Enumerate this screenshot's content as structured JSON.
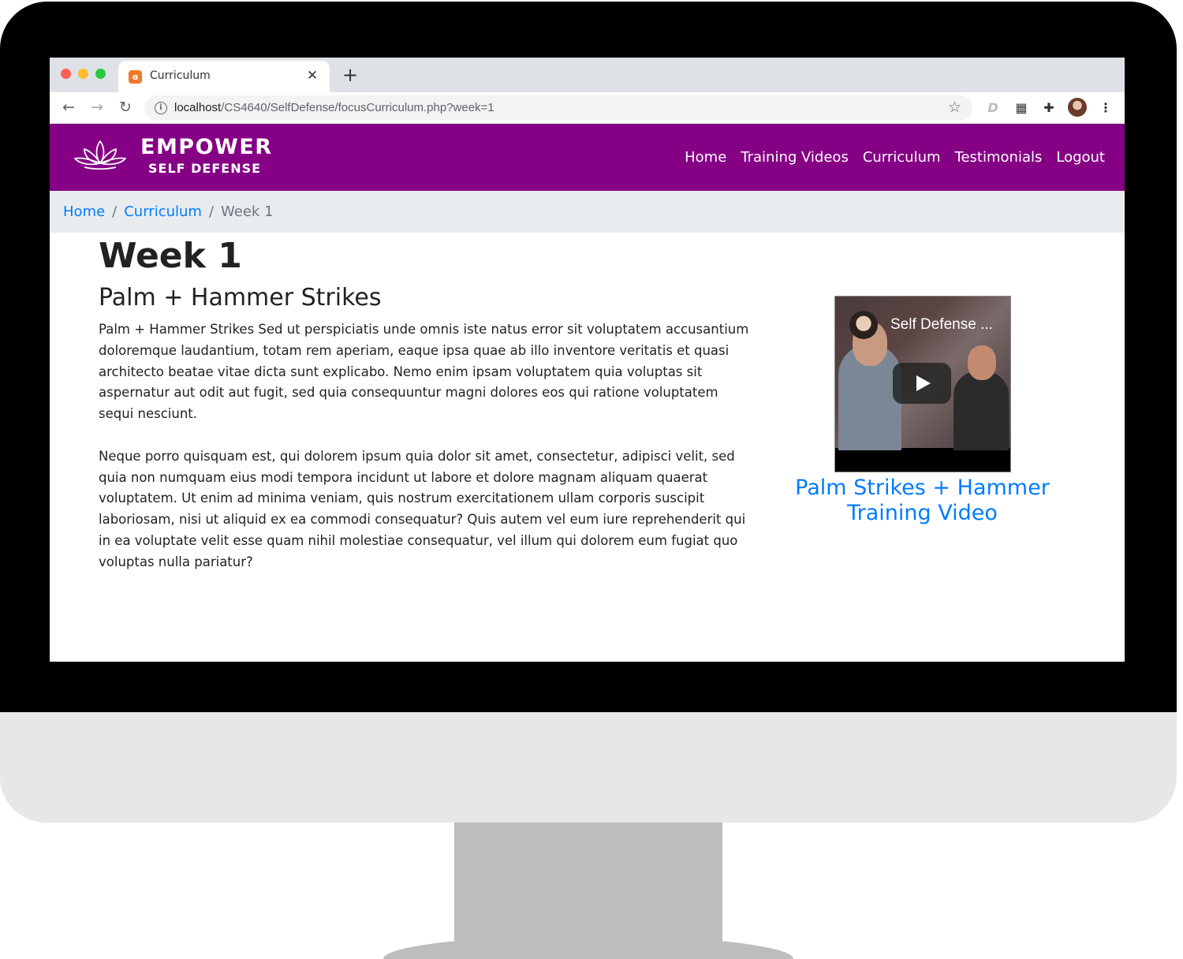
{
  "browser": {
    "tab_title": "Curriculum",
    "url_host": "localhost",
    "url_path": "/CS4640/SelfDefense/focusCurriculum.php?week=1"
  },
  "site": {
    "brand_name": "EMPOWER",
    "brand_sub": "SELF DEFENSE",
    "nav": [
      "Home",
      "Training Videos",
      "Curriculum",
      "Testimonials",
      "Logout"
    ],
    "brand_color": "#850085"
  },
  "breadcrumb": {
    "items": [
      "Home",
      "Curriculum"
    ],
    "current": "Week 1"
  },
  "content": {
    "week_title": "Week 1",
    "lesson_title": "Palm + Hammer Strikes",
    "paragraphs": [
      "Palm + Hammer Strikes Sed ut perspiciatis unde omnis iste natus error sit voluptatem accusantium doloremque laudantium, totam rem aperiam, eaque ipsa quae ab illo inventore veritatis et quasi architecto beatae vitae dicta sunt explicabo. Nemo enim ipsam voluptatem quia voluptas sit aspernatur aut odit aut fugit, sed quia consequuntur magni dolores eos qui ratione voluptatem sequi nesciunt.",
      "Neque porro quisquam est, qui dolorem ipsum quia dolor sit amet, consectetur, adipisci velit, sed quia non numquam eius modi tempora incidunt ut labore et dolore magnam aliquam quaerat voluptatem. Ut enim ad minima veniam, quis nostrum exercitationem ullam corporis suscipit laboriosam, nisi ut aliquid ex ea commodi consequatur? Quis autem vel eum iure reprehenderit qui in ea voluptate velit esse quam nihil molestiae consequatur, vel illum qui dolorem eum fugiat quo voluptas nulla pariatur?"
    ]
  },
  "video": {
    "overlay_title": "Self Defense ...",
    "link_text": "Palm Strikes + Hammer Training Video"
  }
}
